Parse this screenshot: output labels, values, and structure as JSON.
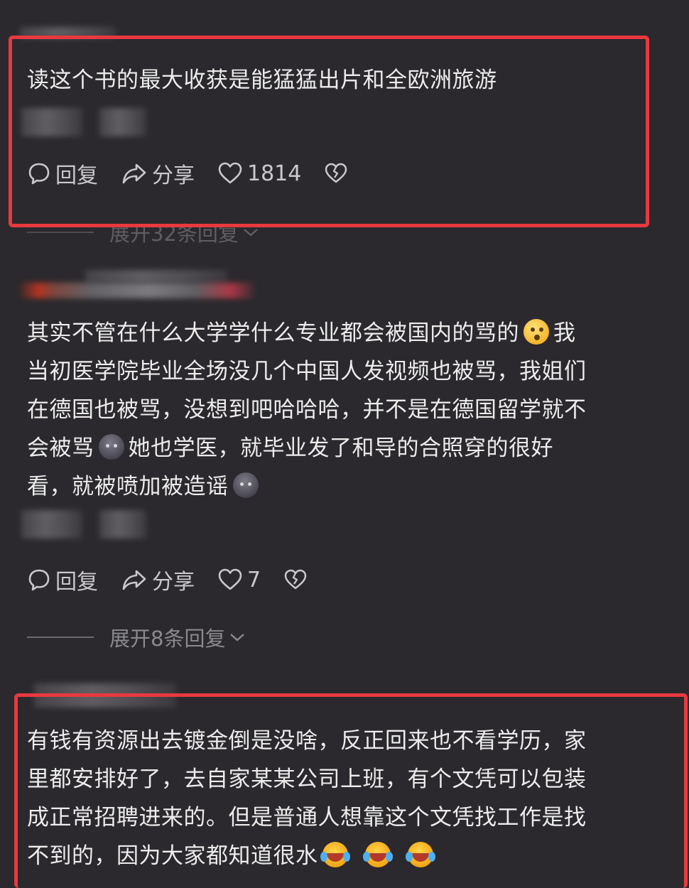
{
  "comments": [
    {
      "text_lines": [
        "读这个书的最大收获是能猛猛出片和全欧洲旅游"
      ],
      "actions": {
        "reply": "回复",
        "share": "分享",
        "likes": "1814"
      },
      "expand": "展开32条回复"
    },
    {
      "text_lines": [
        "其实不管在什么大学学什么专业都会被国内的骂的",
        "我",
        "当初医学院毕业全场没几个中国人发视频也被骂，我姐们",
        "在德国也被骂，没想到吧哈哈哈，并不是在德国留学就不",
        "会被骂",
        "她也学医，就毕业发了和导的合照穿的很好",
        "看，就被喷加被造谣"
      ],
      "actions": {
        "reply": "回复",
        "share": "分享",
        "likes": "7"
      },
      "expand": "展开8条回复"
    },
    {
      "text_lines": [
        "有钱有资源出去镀金倒是没啥，反正回来也不看学历，家",
        "里都安排好了，去自家某某公司上班，有个文凭可以包装",
        "成正常招聘进来的。但是普通人想靠这个文凭找工作是找",
        "不到的，因为大家都知道很水"
      ]
    }
  ],
  "colors": {
    "background": "#2b292d",
    "highlight": "#e8393f",
    "text": "#ececec",
    "muted": "#8a898c"
  },
  "icons": [
    "comment-bubble-icon",
    "share-arrow-icon",
    "heart-icon",
    "broken-heart-icon",
    "chevron-down-icon"
  ]
}
